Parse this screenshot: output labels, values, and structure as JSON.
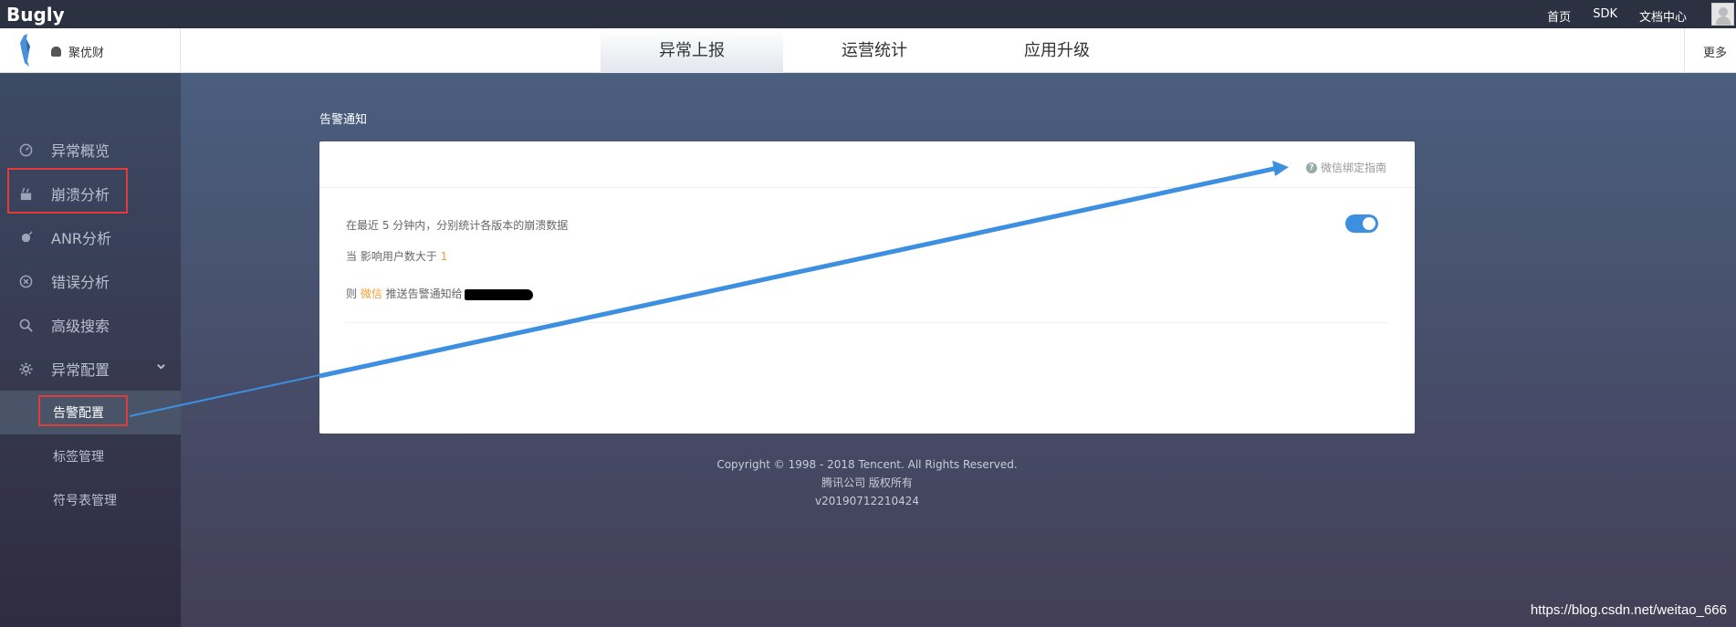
{
  "topbar": {
    "brand": "Bugly",
    "links": [
      "首页",
      "SDK",
      "文档中心"
    ]
  },
  "appbar": {
    "app_name": "聚优财",
    "tabs": [
      {
        "label": "异常上报",
        "active": true
      },
      {
        "label": "运营统计",
        "active": false
      },
      {
        "label": "应用升级",
        "active": false
      }
    ],
    "more": "更多"
  },
  "sidebar": {
    "items": [
      {
        "label": "异常概览",
        "icon": "dashboard-icon"
      },
      {
        "label": "崩溃分析",
        "icon": "crash-icon"
      },
      {
        "label": "ANR分析",
        "icon": "snail-icon"
      },
      {
        "label": "错误分析",
        "icon": "error-circle-icon"
      },
      {
        "label": "高级搜索",
        "icon": "search-icon"
      },
      {
        "label": "异常配置",
        "icon": "gear-icon"
      }
    ],
    "subitems": [
      {
        "label": "告警配置",
        "active": true
      },
      {
        "label": "标签管理",
        "active": false
      },
      {
        "label": "符号表管理",
        "active": false
      }
    ]
  },
  "main": {
    "section_title": "告警通知",
    "help_link": "微信绑定指南",
    "rule": {
      "line1": "在最近 5 分钟内，分别统计各版本的崩溃数据",
      "line2_prefix": "当 影响用户数大于 ",
      "line2_value": "1",
      "line3_prefix": "则 ",
      "line3_channel": "微信",
      "line3_suffix": " 推送告警通知给"
    },
    "toggle_on": true
  },
  "footer": {
    "copyright": "Copyright © 1998 - 2018 Tencent. All Rights Reserved.",
    "company": "腾讯公司 版权所有",
    "version": "v20190712210424"
  },
  "watermark": "https://blog.csdn.net/weitao_666",
  "colors": {
    "accent": "#3d8fe0",
    "highlight": "#f0a030",
    "annotation_red": "#e23b3b"
  }
}
